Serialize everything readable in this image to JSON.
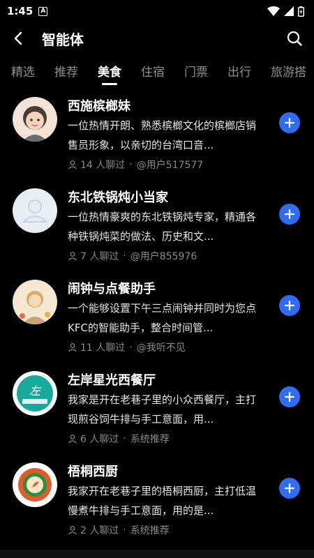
{
  "status": {
    "time": "1:45"
  },
  "header": {
    "title": "智能体"
  },
  "tabs": [
    {
      "label": "精选"
    },
    {
      "label": "推荐"
    },
    {
      "label": "美食"
    },
    {
      "label": "住宿"
    },
    {
      "label": "门票"
    },
    {
      "label": "出行"
    },
    {
      "label": "旅游搭"
    }
  ],
  "active_tab": "美食",
  "items": [
    {
      "name": "西施槟榔妹",
      "desc": "一位热情开朗、熟悉槟榔文化的槟榔店销售员形象，以亲切的台湾口音...",
      "chat_count": "14 人聊过",
      "author": "@用户517577",
      "avatar_bg": "#f3e3d6"
    },
    {
      "name": "东北铁锅炖小当家",
      "desc": "一位热情豪爽的东北铁锅炖专家，精通各种铁锅炖菜的做法、历史和文...",
      "chat_count": "7 人聊过",
      "author": "@用户855976",
      "avatar_bg": "#e8edf3"
    },
    {
      "name": "闹钟与点餐助手",
      "desc": "一个能够设置下午三点闹钟并同时为您点KFC的智能助手，整合时间管...",
      "chat_count": "11 人聊过",
      "author": "@我听不见",
      "avatar_bg": "#f4e7d2"
    },
    {
      "name": "左岸星光西餐厅",
      "desc": "我家是开在老巷子里的小众西餐厅，主打现煎谷饲牛排与手工意面，用...",
      "chat_count": "6 人聊过",
      "author": "系统推荐",
      "avatar_bg": "#ffffff"
    },
    {
      "name": "梧桐西厨",
      "desc": "我家开在老巷子里的梧桐西厨，主打低温慢煮牛排与手工意面，用的是...",
      "chat_count": "2 人聊过",
      "author": "系统推荐",
      "avatar_bg": "#ffffff"
    }
  ],
  "separator": "·",
  "accent": "#2f6df6"
}
